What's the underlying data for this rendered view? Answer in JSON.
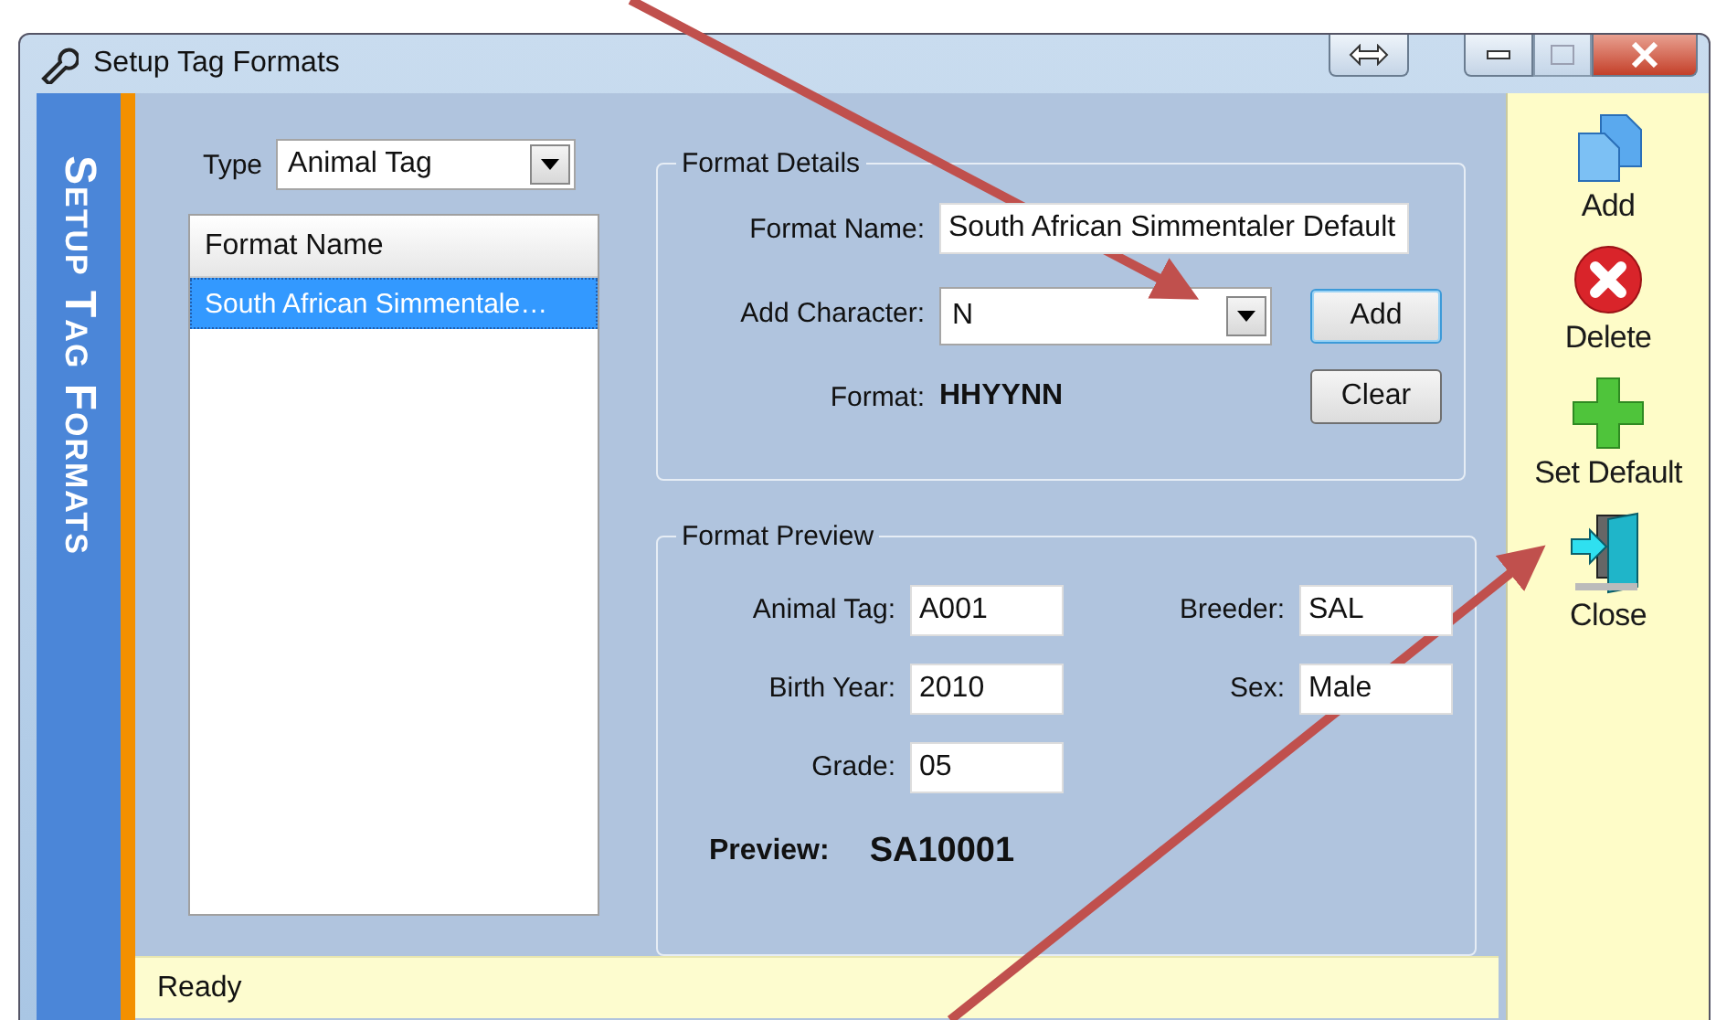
{
  "window": {
    "title": "Setup Tag Formats"
  },
  "side_banner": "Setup Tag Formats",
  "type_filter": {
    "label": "Type",
    "value": "Animal Tag"
  },
  "format_list": {
    "columns": [
      "Format Name"
    ],
    "rows": [
      {
        "name": "South African Simmentale…",
        "selected": true
      }
    ]
  },
  "format_details": {
    "title": "Format Details",
    "format_name": {
      "label": "Format Name:",
      "value": "South African Simmentaler Default"
    },
    "add_character": {
      "label": "Add Character:",
      "value": "N"
    },
    "add_button": "Add",
    "clear_button": "Clear",
    "format": {
      "label": "Format:",
      "value": "HHYYNN"
    }
  },
  "format_preview": {
    "title": "Format Preview",
    "fields": [
      {
        "label": "Animal Tag:",
        "value": "A001"
      },
      {
        "label": "Breeder:",
        "value": "SAL"
      },
      {
        "label": "Birth Year:",
        "value": "2010"
      },
      {
        "label": "Sex:",
        "value": "Male"
      },
      {
        "label": "Grade:",
        "value": "05"
      }
    ],
    "preview": {
      "label": "Preview:",
      "value": "SA10001"
    }
  },
  "actions": [
    {
      "kind": "add",
      "label": "Add"
    },
    {
      "kind": "delete",
      "label": "Delete"
    },
    {
      "kind": "set_default",
      "label": "Set Default"
    },
    {
      "kind": "close",
      "label": "Close"
    }
  ],
  "status_bar": "Ready"
}
